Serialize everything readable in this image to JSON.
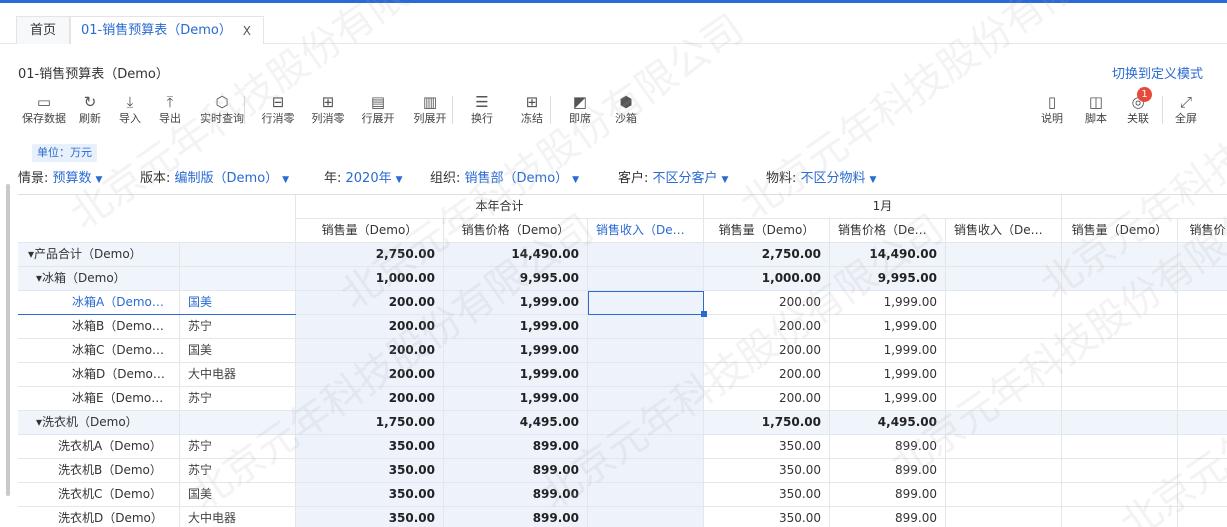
{
  "tabs": {
    "home": "首页",
    "active": "01-销售预算表（Demo）",
    "close": "X"
  },
  "page": {
    "title": "01-销售预算表（Demo）",
    "switch_link": "切换到定义模式",
    "unit_tag": "单位：万元"
  },
  "toolbar": {
    "left": [
      {
        "label": "保存数据",
        "icon": "save-icon",
        "glyph": "▭"
      },
      {
        "label": "刷新",
        "icon": "refresh-icon",
        "glyph": "↻"
      },
      {
        "label": "导入",
        "icon": "import-icon",
        "glyph": "⤓"
      },
      {
        "label": "导出",
        "icon": "export-icon",
        "glyph": "⤒"
      },
      {
        "label": "实时查询",
        "icon": "realtime-query-icon",
        "glyph": "⬡"
      },
      {
        "label": "行消零",
        "icon": "row-zero-icon",
        "glyph": "⊟"
      },
      {
        "label": "列消零",
        "icon": "col-zero-icon",
        "glyph": "⊞"
      },
      {
        "label": "行展开",
        "icon": "row-expand-icon",
        "glyph": "▤"
      },
      {
        "label": "列展开",
        "icon": "col-expand-icon",
        "glyph": "▥"
      },
      {
        "label": "换行",
        "icon": "wrap-icon",
        "glyph": "☰"
      },
      {
        "label": "冻结",
        "icon": "freeze-icon",
        "glyph": "⊞"
      },
      {
        "label": "即席",
        "icon": "adhoc-icon",
        "glyph": "◩"
      },
      {
        "label": "沙箱",
        "icon": "sandbox-icon",
        "glyph": "⬢"
      }
    ],
    "right": [
      {
        "label": "说明",
        "icon": "doc-icon",
        "glyph": "▯"
      },
      {
        "label": "脚本",
        "icon": "script-icon",
        "glyph": "◫"
      },
      {
        "label": "关联",
        "icon": "link-icon",
        "glyph": "◎",
        "badge": "1"
      },
      {
        "label": "全屏",
        "icon": "fullscreen-icon",
        "glyph": "⤢"
      }
    ]
  },
  "filters": [
    {
      "key": "情景:",
      "value": "预算数"
    },
    {
      "key": "版本:",
      "value": "编制版（Demo）"
    },
    {
      "key": "年:",
      "value": "2020年"
    },
    {
      "key": "组织:",
      "value": "销售部（Demo）"
    },
    {
      "key": "客户:",
      "value": "不区分客户"
    },
    {
      "key": "物料:",
      "value": "不区分物料"
    }
  ],
  "grid": {
    "group_headers": [
      "本年合计",
      "1月"
    ],
    "column_headers": [
      "销售量（Demo）",
      "销售价格（Demo）",
      "销售收入（Demo...",
      "销售量（Demo）",
      "销售价格（Demo...",
      "销售收入（Demo...",
      "销售量（Demo）",
      "销售价"
    ],
    "rows": [
      {
        "name": "▾产品合计（Demo）",
        "customer": "",
        "qty": "2,750.00",
        "price": "14,490.00",
        "m_qty": "2,750.00",
        "m_price": "14,490.00",
        "level": "total"
      },
      {
        "name": "▾冰箱（Demo）",
        "customer": "",
        "qty": "1,000.00",
        "price": "9,995.00",
        "m_qty": "1,000.00",
        "m_price": "9,995.00",
        "level": "group"
      },
      {
        "name": "冰箱A（Demo）",
        "customer": "国美",
        "qty": "200.00",
        "price": "1,999.00",
        "m_qty": "200.00",
        "m_price": "1,999.00",
        "level": "leaf",
        "selected": true
      },
      {
        "name": "冰箱B（Demo）",
        "customer": "苏宁",
        "qty": "200.00",
        "price": "1,999.00",
        "m_qty": "200.00",
        "m_price": "1,999.00",
        "level": "leaf"
      },
      {
        "name": "冰箱C（Demo）",
        "customer": "国美",
        "qty": "200.00",
        "price": "1,999.00",
        "m_qty": "200.00",
        "m_price": "1,999.00",
        "level": "leaf"
      },
      {
        "name": "冰箱D（Demo）",
        "customer": "大中电器",
        "qty": "200.00",
        "price": "1,999.00",
        "m_qty": "200.00",
        "m_price": "1,999.00",
        "level": "leaf"
      },
      {
        "name": "冰箱E（Demo）",
        "customer": "苏宁",
        "qty": "200.00",
        "price": "1,999.00",
        "m_qty": "200.00",
        "m_price": "1,999.00",
        "level": "leaf"
      },
      {
        "name": "▾洗衣机（Demo）",
        "customer": "",
        "qty": "1,750.00",
        "price": "4,495.00",
        "m_qty": "1,750.00",
        "m_price": "4,495.00",
        "level": "group"
      },
      {
        "name": "洗衣机A（Demo）",
        "customer": "苏宁",
        "qty": "350.00",
        "price": "899.00",
        "m_qty": "350.00",
        "m_price": "899.00",
        "level": "leaf2"
      },
      {
        "name": "洗衣机B（Demo）",
        "customer": "苏宁",
        "qty": "350.00",
        "price": "899.00",
        "m_qty": "350.00",
        "m_price": "899.00",
        "level": "leaf2"
      },
      {
        "name": "洗衣机C（Demo）",
        "customer": "国美",
        "qty": "350.00",
        "price": "899.00",
        "m_qty": "350.00",
        "m_price": "899.00",
        "level": "leaf2"
      },
      {
        "name": "洗衣机D（Demo）",
        "customer": "大中电器",
        "qty": "350.00",
        "price": "899.00",
        "m_qty": "350.00",
        "m_price": "899.00",
        "level": "leaf2"
      }
    ]
  },
  "watermark": "北京元年科技股份有限公司",
  "colors": {
    "accent": "#2a6ad2",
    "badge": "#e84a3a",
    "shade": "#edf2fb"
  }
}
